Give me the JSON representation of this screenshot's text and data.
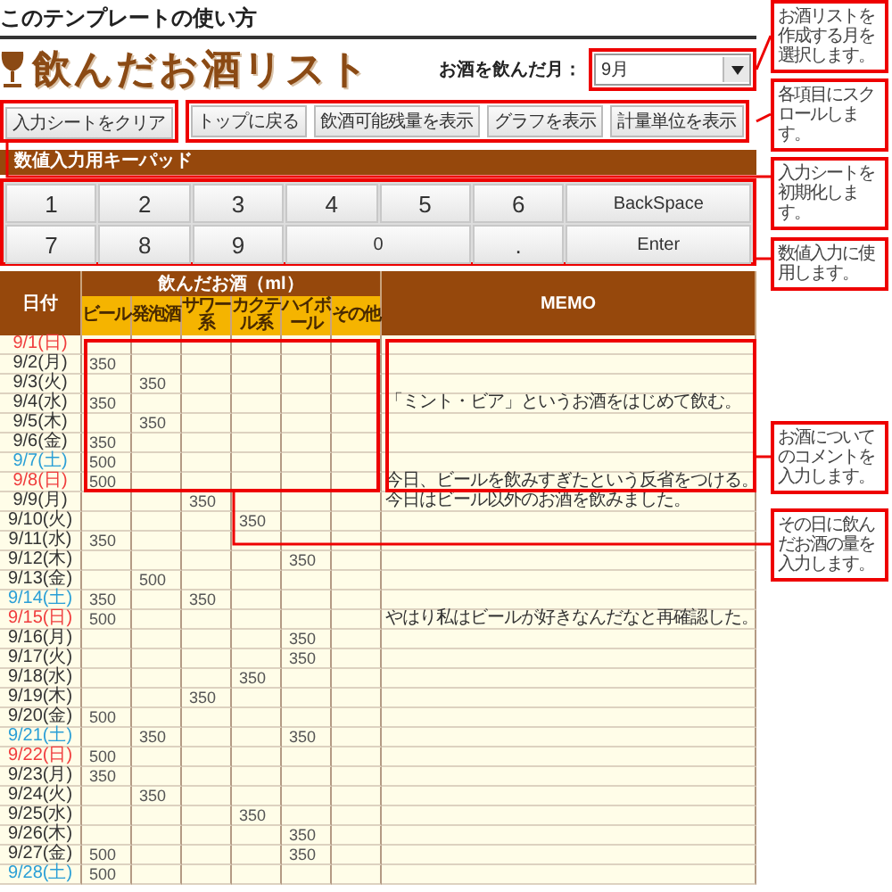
{
  "heading": "このテンプレートの使い方",
  "title": "飲んだお酒リスト",
  "month": {
    "label": "お酒を飲んだ月：",
    "value": "9月"
  },
  "clear_button": "入力シートをクリア",
  "nav_buttons": [
    "トップに戻る",
    "飲酒可能残量を表示",
    "グラフを表示",
    "計量単位を表示"
  ],
  "keypad": {
    "title": "数値入力用キーパッド",
    "keys": [
      {
        "label": "1",
        "kind": "key"
      },
      {
        "label": "2",
        "kind": "key"
      },
      {
        "label": "3",
        "kind": "key"
      },
      {
        "label": "4",
        "kind": "key"
      },
      {
        "label": "5",
        "kind": "key"
      },
      {
        "label": "6",
        "kind": "key"
      },
      {
        "label": "BackSpace",
        "kind": "wide"
      },
      {
        "label": "7",
        "kind": "key"
      },
      {
        "label": "8",
        "kind": "key"
      },
      {
        "label": "9",
        "kind": "key"
      },
      {
        "label": "0",
        "kind": "wide"
      },
      {
        "label": ".",
        "kind": "key"
      },
      {
        "label": "Enter",
        "kind": "wide"
      }
    ]
  },
  "table": {
    "date_header": "日付",
    "drinks_header": "飲んだお酒（ml）",
    "memo_header": "MEMO",
    "drink_columns": {
      "beer": "ビール",
      "happoshu": "発泡酒",
      "sour": "サワー系",
      "cocktail": "カクテル系",
      "highball": "ハイボール",
      "other": "その他"
    },
    "rows": [
      {
        "date": "9/1(日)",
        "kind": "sunday",
        "amounts": {}
      },
      {
        "date": "9/2(月)",
        "kind": "weekday",
        "amounts": {
          "beer": "350"
        }
      },
      {
        "date": "9/3(火)",
        "kind": "weekday",
        "amounts": {
          "happoshu": "350"
        }
      },
      {
        "date": "9/4(水)",
        "kind": "weekday",
        "amounts": {
          "beer": "350"
        },
        "memo": "「ミント・ビア」というお酒をはじめて飲む。"
      },
      {
        "date": "9/5(木)",
        "kind": "weekday",
        "amounts": {
          "happoshu": "350"
        }
      },
      {
        "date": "9/6(金)",
        "kind": "weekday",
        "amounts": {
          "beer": "350"
        }
      },
      {
        "date": "9/7(土)",
        "kind": "saturday",
        "amounts": {
          "beer": "500"
        }
      },
      {
        "date": "9/8(日)",
        "kind": "sunday",
        "amounts": {
          "beer": "500"
        },
        "memo": "今日、ビールを飲みすぎたという反省をつける。"
      },
      {
        "date": "9/9(月)",
        "kind": "weekday",
        "amounts": {
          "sour": "350"
        },
        "memo": "今日はビール以外のお酒を飲みました。"
      },
      {
        "date": "9/10(火)",
        "kind": "weekday",
        "amounts": {
          "cocktail": "350"
        }
      },
      {
        "date": "9/11(水)",
        "kind": "weekday",
        "amounts": {
          "beer": "350"
        }
      },
      {
        "date": "9/12(木)",
        "kind": "weekday",
        "amounts": {
          "highball": "350"
        }
      },
      {
        "date": "9/13(金)",
        "kind": "weekday",
        "amounts": {
          "happoshu": "500"
        }
      },
      {
        "date": "9/14(土)",
        "kind": "saturday",
        "amounts": {
          "beer": "350",
          "sour": "350"
        }
      },
      {
        "date": "9/15(日)",
        "kind": "sunday",
        "amounts": {
          "beer": "500"
        },
        "memo": "やはり私はビールが好きなんだなと再確認した。"
      },
      {
        "date": "9/16(月)",
        "kind": "weekday",
        "amounts": {
          "highball": "350"
        }
      },
      {
        "date": "9/17(火)",
        "kind": "weekday",
        "amounts": {
          "highball": "350"
        }
      },
      {
        "date": "9/18(水)",
        "kind": "weekday",
        "amounts": {
          "cocktail": "350"
        }
      },
      {
        "date": "9/19(木)",
        "kind": "weekday",
        "amounts": {
          "sour": "350"
        }
      },
      {
        "date": "9/20(金)",
        "kind": "weekday",
        "amounts": {
          "beer": "500"
        }
      },
      {
        "date": "9/21(土)",
        "kind": "saturday",
        "amounts": {
          "happoshu": "350",
          "highball": "350"
        }
      },
      {
        "date": "9/22(日)",
        "kind": "sunday",
        "amounts": {
          "beer": "500"
        }
      },
      {
        "date": "9/23(月)",
        "kind": "weekday",
        "amounts": {
          "beer": "350"
        }
      },
      {
        "date": "9/24(火)",
        "kind": "weekday",
        "amounts": {
          "happoshu": "350"
        }
      },
      {
        "date": "9/25(水)",
        "kind": "weekday",
        "amounts": {
          "cocktail": "350"
        }
      },
      {
        "date": "9/26(木)",
        "kind": "weekday",
        "amounts": {
          "highball": "350"
        }
      },
      {
        "date": "9/27(金)",
        "kind": "weekday",
        "amounts": {
          "beer": "500",
          "highball": "350"
        }
      },
      {
        "date": "9/28(土)",
        "kind": "saturday",
        "amounts": {
          "beer": "500"
        }
      }
    ]
  },
  "annotations": [
    {
      "text": "お酒リストを作成する月を選択します。"
    },
    {
      "text": "各項目にスクロールします。"
    },
    {
      "text": "入力シートを初期化します。"
    },
    {
      "text": "数値入力に使用します。"
    },
    {
      "text": "お酒についてのコメントを入力します。"
    },
    {
      "text": "その日に飲んだお酒の量を入力します。"
    }
  ]
}
